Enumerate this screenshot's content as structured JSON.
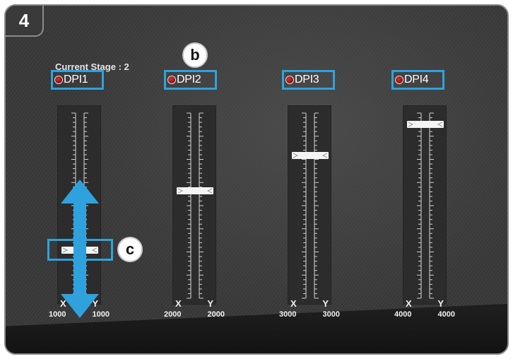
{
  "step": {
    "number": "4"
  },
  "current_stage": "Current Stage : 2",
  "callouts": {
    "b": "b",
    "c": "c"
  },
  "accent_color": "#2fa2dd",
  "stages": [
    {
      "label": "DPI1",
      "x_label": "X",
      "y_label": "Y",
      "x_value": "1000",
      "y_value": "1000",
      "level_fraction": 0.26,
      "active_indicator": true
    },
    {
      "label": "DPI2",
      "x_label": "X",
      "y_label": "Y",
      "x_value": "2000",
      "y_value": "2000",
      "level_fraction": 0.58,
      "active_indicator": true
    },
    {
      "label": "DPI3",
      "x_label": "X",
      "y_label": "Y",
      "x_value": "3000",
      "y_value": "3000",
      "level_fraction": 0.77,
      "active_indicator": true
    },
    {
      "label": "DPI4",
      "x_label": "X",
      "y_label": "Y",
      "x_value": "4000",
      "y_value": "4000",
      "level_fraction": 0.94,
      "active_indicator": true
    }
  ],
  "icons": [
    "step-number-icon",
    "double-arrow-icon",
    "indicator-dot-icon",
    "slider-knob-icon"
  ]
}
